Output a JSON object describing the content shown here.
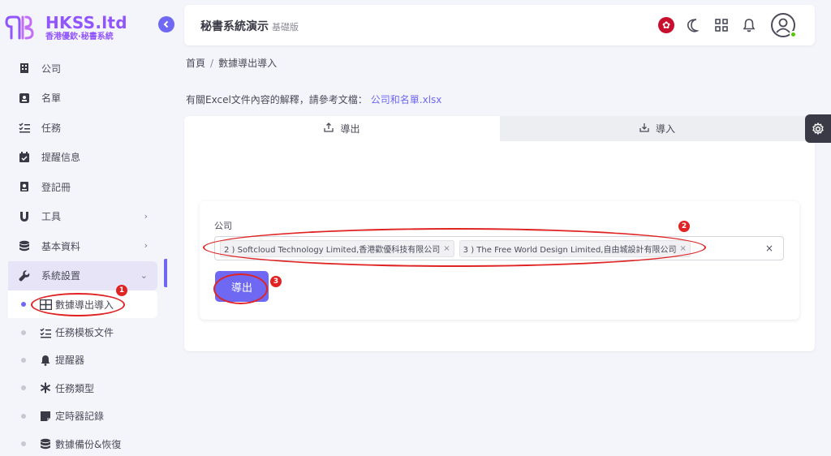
{
  "logo": {
    "title": "HKSS.ltd",
    "subtitle": "香港優欽·秘書系統"
  },
  "nav": {
    "items": [
      {
        "label": "公司",
        "icon": "building-icon"
      },
      {
        "label": "名單",
        "icon": "contact-card-icon"
      },
      {
        "label": "任務",
        "icon": "checklist-icon"
      },
      {
        "label": "提醒信息",
        "icon": "calendar-check-icon"
      },
      {
        "label": "登記冊",
        "icon": "register-book-icon"
      },
      {
        "label": "工具",
        "icon": "magnet-icon"
      },
      {
        "label": "基本資料",
        "icon": "database-icon"
      },
      {
        "label": "系統設置",
        "icon": "wrench-icon"
      }
    ],
    "sub_items": [
      {
        "label": "數據導出導入",
        "icon": "table-icon"
      },
      {
        "label": "任務模板文件",
        "icon": "checklist-icon"
      },
      {
        "label": "提醒器",
        "icon": "bell-icon"
      },
      {
        "label": "任務類型",
        "icon": "asterisk-icon"
      },
      {
        "label": "定時器記錄",
        "icon": "note-icon"
      },
      {
        "label": "數據備份&恢復",
        "icon": "database-icon"
      }
    ]
  },
  "topbar": {
    "title": "秘書系統演示",
    "subtitle": "基礎版"
  },
  "breadcrumb": {
    "home": "首頁",
    "sep": "/",
    "current": "數據導出導入"
  },
  "note": {
    "text": "有關Excel文件內容的解釋，請參考文檔：",
    "link": "公司和名單.xlsx"
  },
  "tabs": {
    "export": "導出",
    "import": "導入"
  },
  "form": {
    "label": "公司",
    "tags": [
      "2 ) Softcloud Technology Limited,香港歡優科技有限公司",
      "3 ) The Free World Design Limited,自由城設計有限公司"
    ],
    "tag_remove": "×",
    "clear": "×",
    "button": "導出"
  },
  "annotations": [
    "1",
    "2",
    "3"
  ],
  "colors": {
    "accent": "#6f68f2",
    "annotation": "#e02424",
    "hk_flag": "#c8102e"
  }
}
